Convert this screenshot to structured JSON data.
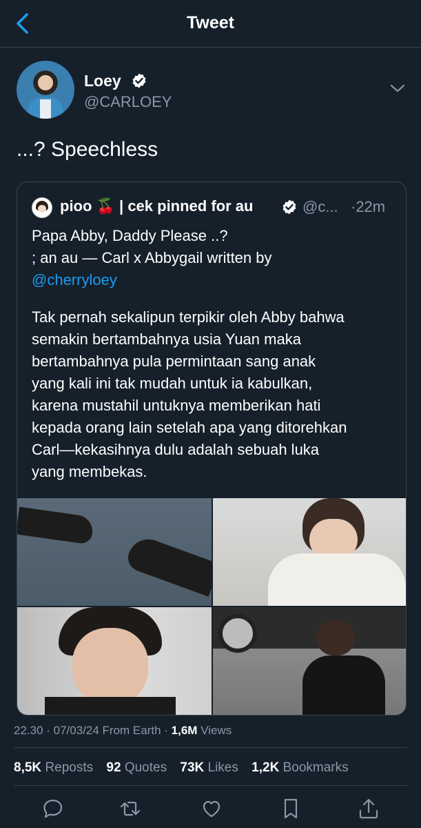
{
  "header": {
    "title": "Tweet",
    "back_icon": "chevron-left-icon"
  },
  "author": {
    "name": "Loey",
    "handle": "@CARLOEY",
    "verified": true
  },
  "tweet": {
    "text": "...? Speechless"
  },
  "quote": {
    "name": "pioo 🍒 | cek pinned for au",
    "handle": "@c...",
    "time": "·22m",
    "body": {
      "line1": "Papa Abby, Daddy Please ..?",
      "line2": "; an au — Carl x Abbygail written by",
      "link": "@cherryloey",
      "p2": [
        "Tak pernah sekalipun terpikir oleh Abby bahwa",
        "semakin bertambahnya usia Yuan maka",
        "bertambahnya pula permintaan sang anak",
        "yang kali ini tak mudah untuk ia kabulkan,",
        "karena mustahil untuknya memberikan hati",
        "kepada orang lain setelah apa yang ditorehkan",
        "Carl—kekasihnya dulu adalah sebuah luka",
        "yang membekas."
      ]
    }
  },
  "meta": {
    "time": "22.30 · 07/03/24 From Earth · ",
    "views_count": "1,6M",
    "views_label": " Views"
  },
  "stats": {
    "reposts": {
      "count": "8,5K",
      "label": " Reposts"
    },
    "quotes": {
      "count": "92",
      "label": " Quotes"
    },
    "likes": {
      "count": "73K",
      "label": " Likes"
    },
    "bookmarks": {
      "count": "1,2K",
      "label": " Bookmarks"
    }
  },
  "colors": {
    "background": "#15202b",
    "accent": "#1d9bf0",
    "secondary_text": "#8b98a5",
    "divider": "#38444d"
  }
}
